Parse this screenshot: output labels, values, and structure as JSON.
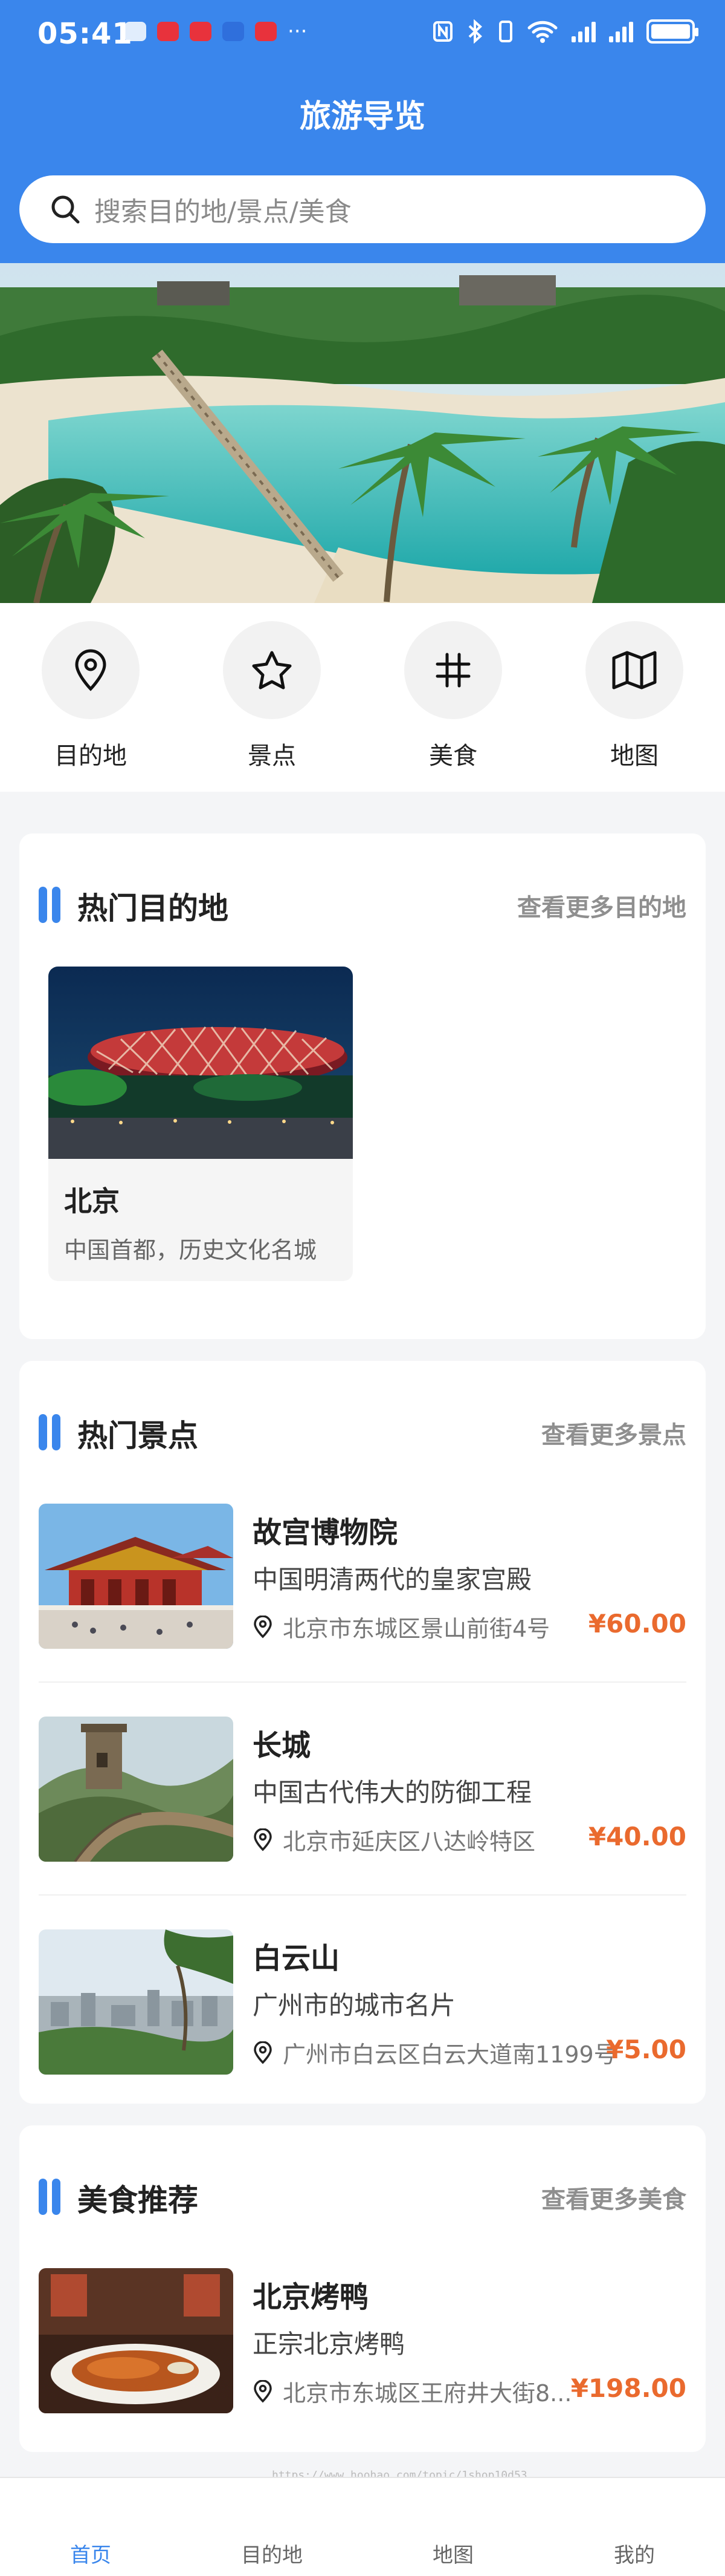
{
  "status_bar": {
    "time": "05:41",
    "more_dots": "···"
  },
  "header": {
    "title": "旅游导览"
  },
  "search": {
    "placeholder": "搜索目的地/景点/美食"
  },
  "quick_nav": [
    {
      "label": "目的地",
      "icon": "location-pin-icon"
    },
    {
      "label": "景点",
      "icon": "star-icon"
    },
    {
      "label": "美食",
      "icon": "hash-icon"
    },
    {
      "label": "地图",
      "icon": "map-icon"
    }
  ],
  "hot_destinations": {
    "title": "热门目的地",
    "more": "查看更多目的地",
    "items": [
      {
        "name": "北京",
        "desc": "中国首都，历史文化名城"
      }
    ]
  },
  "hot_spots": {
    "title": "热门景点",
    "more": "查看更多景点",
    "items": [
      {
        "name": "故宫博物院",
        "desc": "中国明清两代的皇家宫殿",
        "address": "北京市东城区景山前街4号",
        "price": "¥60.00"
      },
      {
        "name": "长城",
        "desc": "中国古代伟大的防御工程",
        "address": "北京市延庆区八达岭特区",
        "price": "¥40.00"
      },
      {
        "name": "白云山",
        "desc": "广州市的城市名片",
        "address": "广州市白云区白云大道南1199号",
        "price": "¥5.00"
      }
    ]
  },
  "food": {
    "title": "美食推荐",
    "more": "查看更多美食",
    "items": [
      {
        "name": "北京烤鸭",
        "desc": "正宗北京烤鸭",
        "address": "北京市东城区王府井大街8...",
        "price": "¥198.00"
      }
    ]
  },
  "tabbar": [
    {
      "label": "首页",
      "active": true
    },
    {
      "label": "目的地",
      "active": false
    },
    {
      "label": "地图",
      "active": false
    },
    {
      "label": "我的",
      "active": false
    }
  ],
  "watermark": "https://www.hoohao.com/topic/1shop10d53",
  "colors": {
    "primary": "#3a86ec",
    "price": "#ea6a2e",
    "background": "#f4f5f7"
  }
}
